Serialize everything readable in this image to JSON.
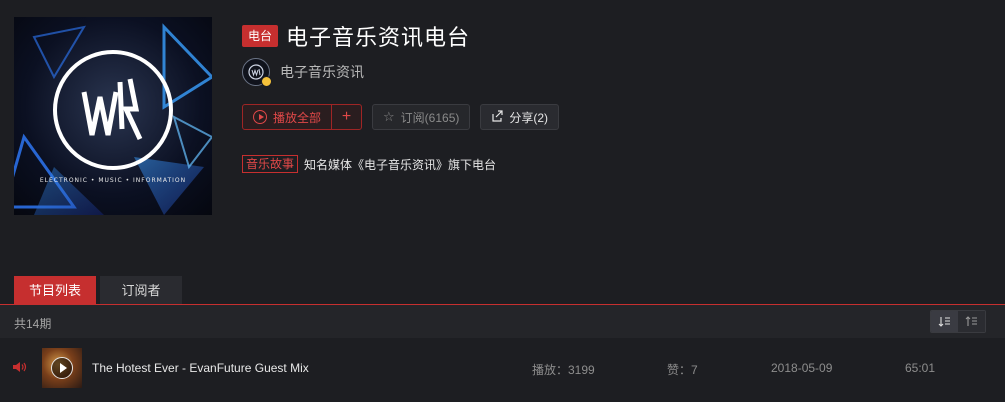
{
  "radio": {
    "type_tag": "电台",
    "title": "电子音乐资讯电台",
    "creator": "电子音乐资讯",
    "cover_caption": "ELECTRONIC • MUSIC • INFORMATION",
    "category": "音乐故事",
    "description": "知名媒体《电子音乐资讯》旗下电台"
  },
  "buttons": {
    "play_all": "播放全部",
    "add": "+",
    "subscribe": "订阅(6165)",
    "share": "分享(2)"
  },
  "tabs": [
    {
      "label": "节目列表",
      "active": true
    },
    {
      "label": "订阅者",
      "active": false
    }
  ],
  "list": {
    "count": "共14期",
    "programs": [
      {
        "title": "The Hotest Ever - EvanFuture Guest Mix",
        "plays": "播放：3199",
        "likes": "赞：7",
        "date": "2018-05-09",
        "duration": "65:01"
      }
    ]
  },
  "icons": {
    "play": "circle-play-icon",
    "subscribe": "star-icon",
    "share": "share-icon",
    "speaker": "speaker-icon",
    "sort_desc": "sort-desc-icon",
    "sort_asc": "sort-asc-icon"
  },
  "colors": {
    "accent": "#c62f2f",
    "background": "#1d1e22"
  }
}
